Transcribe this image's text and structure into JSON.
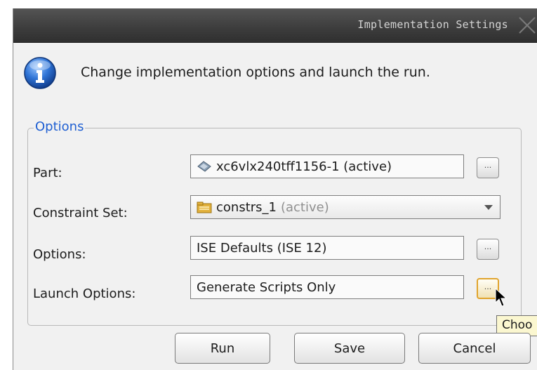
{
  "window": {
    "title": "Implementation Settings"
  },
  "header": {
    "message": "Change implementation options and launch the run."
  },
  "options": {
    "group_label": "Options",
    "part": {
      "label": "Part:",
      "value": "xc6vlx240tff1156-1 (active)"
    },
    "constraint_set": {
      "label": "Constraint Set:",
      "value": "constrs_1",
      "suffix": "(active)"
    },
    "strategy": {
      "label": "Options:",
      "value": "ISE Defaults (ISE 12)"
    },
    "launch": {
      "label": "Launch Options:",
      "value": "Generate Scripts Only"
    },
    "browse_label": "..."
  },
  "tooltip": {
    "text": "Choo"
  },
  "buttons": {
    "run": "Run",
    "save": "Save",
    "cancel": "Cancel"
  },
  "colors": {
    "accent": "#1f5fd2",
    "focus": "#e0a42d",
    "tooltip_bg": "#fbf7d0"
  },
  "icons": {
    "info": "info-icon",
    "part": "chip-icon",
    "constraints": "folder-icon",
    "close": "close-icon",
    "cursor": "mouse-cursor-icon"
  }
}
